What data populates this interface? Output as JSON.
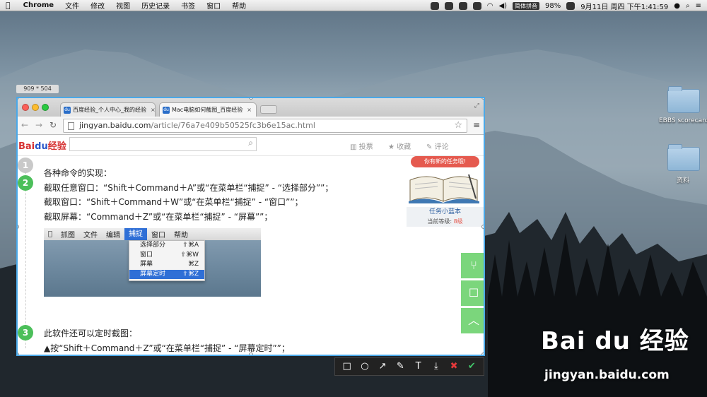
{
  "menubar": {
    "apple": "",
    "app": "Chrome",
    "items": [
      "文件",
      "修改",
      "视图",
      "历史记录",
      "书签",
      "窗口",
      "帮助"
    ],
    "ime": "简体拼音",
    "battery": "98%",
    "clock": "9月11日 周四 下午1:41:59"
  },
  "capture": {
    "size_label": "909 * 504",
    "toolbar_icons": [
      "rectangle-icon",
      "ellipse-icon",
      "arrow-icon",
      "brush-icon",
      "text-icon",
      "save-icon",
      "cancel-icon",
      "confirm-icon"
    ],
    "toolbar_glyphs": [
      "□",
      "○",
      "↗",
      "✎",
      "T",
      "⤓",
      "✖",
      "✔"
    ]
  },
  "browser": {
    "tabs": [
      {
        "title": "百度经验_个人中心_我的经验",
        "close": "×"
      },
      {
        "title": "Mac电脑如何截图_百度经验",
        "close": "×"
      }
    ],
    "url_host": "jingyan.baidu.com",
    "url_path": "/article/76a7e409b50525fc3b6e15ac.html"
  },
  "site": {
    "logo_a": "Bai",
    "logo_b": "du",
    "logo_c": "经验",
    "links": [
      "投票",
      "收藏",
      "评论"
    ],
    "link_icons": [
      "▥",
      "★",
      "✎"
    ]
  },
  "article": {
    "steps": [
      "1",
      "2",
      "3"
    ],
    "line1": "各种命令的实现：",
    "line2": "截取任意窗口：“Shift＋Command＋A”或“在菜单栏“捕捉” - “选择部分””；",
    "line3": "截取窗口：“Shift＋Command＋W”或“在菜单栏“捕捉” - “窗口””；",
    "line4": "截取屏幕：“Command＋Z”或“在菜单栏“捕捉” - “屏幕””；",
    "line5": "此软件还可以定时截图：",
    "line6": "▲按“Shift＋Command＋Z”或“在菜单栏“捕捉” - “屏幕定时””；"
  },
  "mock": {
    "menu": [
      "抓图",
      "文件",
      "编辑",
      "捕捉",
      "窗口",
      "帮助"
    ],
    "items": [
      {
        "label": "选择部分",
        "shortcut": "⇧⌘A"
      },
      {
        "label": "窗口",
        "shortcut": "⇧⌘W"
      },
      {
        "label": "屏幕",
        "shortcut": "⌘Z"
      },
      {
        "label": "屏幕定时",
        "shortcut": "⇧⌘Z"
      }
    ]
  },
  "task": {
    "banner": "你有新的任务哦!",
    "name": "任务小蓝本",
    "level_label": "当前等级:",
    "level_value": "8级"
  },
  "desktop": {
    "folder1": "EBBS scorecard",
    "folder2": "资料"
  },
  "watermark": {
    "logo": "Bai du 经验",
    "url": "jingyan.baidu.com"
  }
}
